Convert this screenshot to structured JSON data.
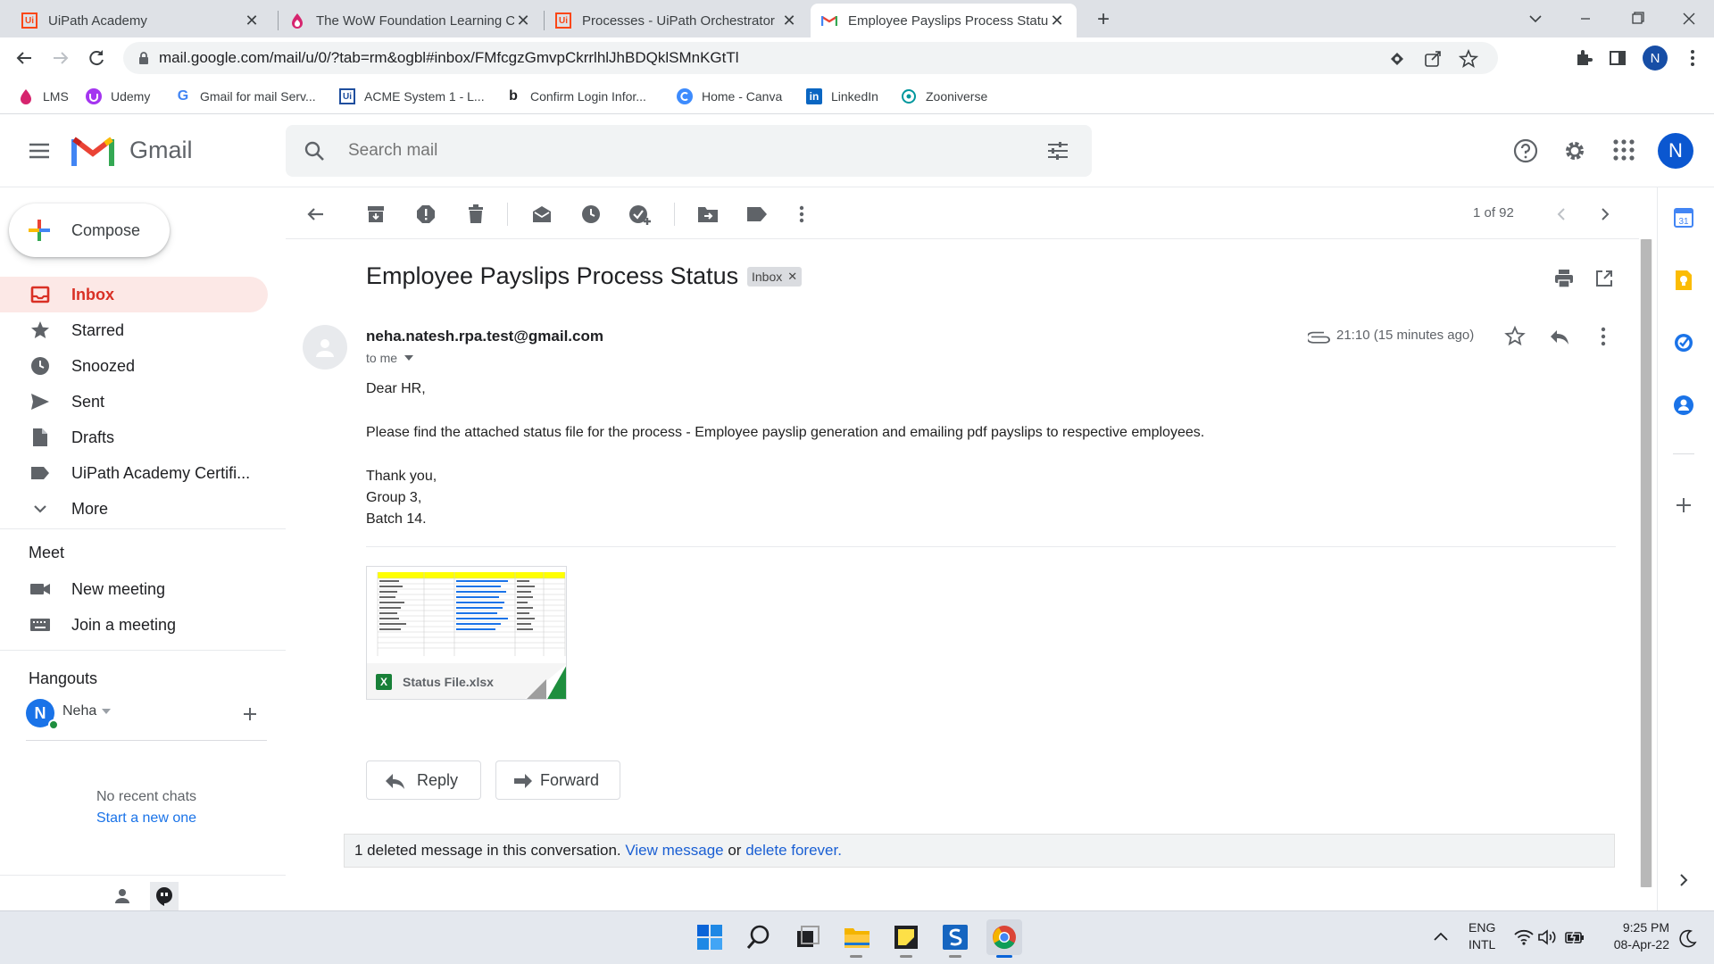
{
  "browser": {
    "tabs": [
      {
        "title": "UiPath Academy"
      },
      {
        "title": "The WoW Foundation Learning C"
      },
      {
        "title": "Processes - UiPath Orchestrator"
      },
      {
        "title": "Employee Payslips Process Statu"
      }
    ],
    "url": "mail.google.com/mail/u/0/?tab=rm&ogbl#inbox/FMfcgzGmvpCkrrlhlJhBDQklSMnKGtTl",
    "profile_initial": "N",
    "bookmarks": [
      {
        "label": "LMS"
      },
      {
        "label": "Udemy"
      },
      {
        "label": "Gmail for mail Serv..."
      },
      {
        "label": "ACME System 1 - L..."
      },
      {
        "label": "Confirm Login Infor..."
      },
      {
        "label": "Home - Canva"
      },
      {
        "label": "LinkedIn"
      },
      {
        "label": "Zooniverse"
      }
    ]
  },
  "gmail": {
    "logo_text": "Gmail",
    "search_placeholder": "Search mail",
    "avatar_initial": "N",
    "compose_label": "Compose",
    "nav": [
      {
        "label": "Inbox"
      },
      {
        "label": "Starred"
      },
      {
        "label": "Snoozed"
      },
      {
        "label": "Sent"
      },
      {
        "label": "Drafts"
      },
      {
        "label": "UiPath Academy Certifi..."
      },
      {
        "label": "More"
      }
    ],
    "meet": {
      "heading": "Meet",
      "new_meeting": "New meeting",
      "join_meeting": "Join a meeting"
    },
    "hangouts": {
      "heading": "Hangouts",
      "user_initial": "N",
      "user_name": "Neha",
      "no_chats": "No recent chats",
      "start_new": "Start a new one"
    },
    "pager": "1 of 92",
    "email": {
      "subject": "Employee Payslips Process Status",
      "label": "Inbox",
      "sender": "neha.natesh.rpa.test@gmail.com",
      "to": "to me",
      "time": "21:10 (15 minutes ago)",
      "body": [
        "Dear HR,",
        "Please find the attached status file for the process - Employee payslip generation and emailing pdf payslips to respective employees.",
        "Thank you,",
        "Group 3,",
        "Batch 14."
      ],
      "attachment_name": "Status File.xlsx",
      "reply_label": "Reply",
      "forward_label": "Forward",
      "deleted_notice": "1 deleted message in this conversation.",
      "view_message": "View message",
      "or_text": "or",
      "delete_forever": "delete forever."
    }
  },
  "taskbar": {
    "lang_top": "ENG",
    "lang_bottom": "INTL",
    "time": "9:25 PM",
    "date": "08-Apr-22"
  },
  "colors": {
    "gmail_red": "#d93025",
    "link_blue": "#1a73e8",
    "avatar_blue": "#1a73e8",
    "inbox_active_bg": "#fce8e6"
  }
}
